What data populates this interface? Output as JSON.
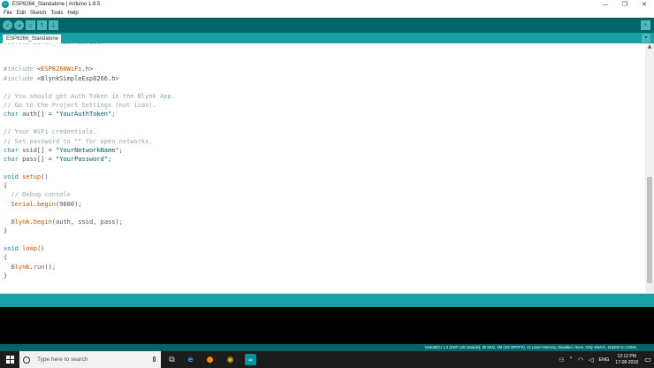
{
  "window": {
    "title": "ESP8266_Standalone | Arduino 1.8.5",
    "controls": {
      "minimize": "—",
      "maximize": "❐",
      "close": "✕"
    }
  },
  "menu": [
    "File",
    "Edit",
    "Sketch",
    "Tools",
    "Help"
  ],
  "toolbar": {
    "buttons": [
      {
        "icon": "verify-icon",
        "glyph": "✓"
      },
      {
        "icon": "upload-icon",
        "glyph": "➔"
      },
      {
        "icon": "new-icon",
        "glyph": "▫"
      },
      {
        "icon": "open-icon",
        "glyph": "↑"
      },
      {
        "icon": "save-icon",
        "glyph": "↓"
      }
    ],
    "serial_monitor_glyph": "⌕"
  },
  "tabs": {
    "active": "ESP8266_Standalone",
    "menu_glyph": "▾"
  },
  "editor": {
    "lines": [
      "#define BLYNK_PRINT Serial",
      "",
      "",
      "#include <ESP8266WiFi.h>",
      "#include <BlynkSimpleEsp8266.h>",
      "",
      "// You should get Auth Token in the Blynk App.",
      "// Go to the Project Settings (nut icon).",
      "char auth[] = \"YourAuthToken\";",
      "",
      "// Your WiFi credentials.",
      "// Set password to \"\" for open networks.",
      "char ssid[] = \"YourNetworkName\";",
      "char pass[] = \"YourPassword\";",
      "",
      "void setup()",
      "{",
      "  // Debug console",
      "  Serial.begin(9600);",
      "",
      "  Blynk.begin(auth, ssid, pass);",
      "}",
      "",
      "void loop()",
      "{",
      "  Blynk.run();",
      "}"
    ]
  },
  "status": {
    "board_info": "NodeMCU 1.0 (ESP-12E Module), 80 MHz, 4M (1M SPIFFS), v2 Lower Memory, Disabled, None, Only Sketch, 115200 on COM4"
  },
  "taskbar": {
    "search_placeholder": "Type here to search",
    "language": "ENG",
    "time": "12:12 PM",
    "date": "17-08-2018"
  },
  "colors": {
    "toolbar": "#006468",
    "tabbar": "#17a1a5",
    "keyword": "#00979c",
    "function": "#d35400",
    "comment": "#95a5a6"
  }
}
